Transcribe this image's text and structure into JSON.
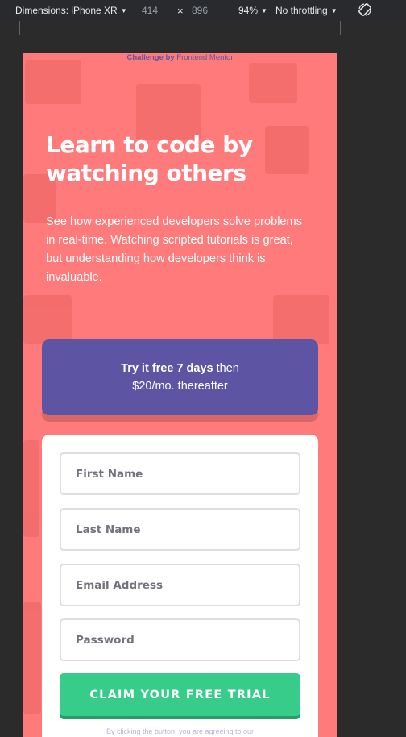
{
  "devtools": {
    "dimensions_label": "Dimensions: iPhone XR",
    "width": "414",
    "times": "×",
    "height": "896",
    "zoom": "94%",
    "throttling": "No throttling",
    "rotate_icon": "rotate-icon"
  },
  "attribution": {
    "prefix": "Challenge by",
    "link": "Frontend Mentor"
  },
  "hero": {
    "headline": "Learn to code by watching others",
    "lead": "See how experienced developers solve problems in real-time. Watching scripted tutorials is great, but understanding how developers think is invaluable."
  },
  "promo": {
    "bold": "Try it free 7 days",
    "rest_line1": " then",
    "line2": "$20/mo. thereafter"
  },
  "form": {
    "first_name_placeholder": "First Name",
    "last_name_placeholder": "Last Name",
    "email_placeholder": "Email Address",
    "password_placeholder": "Password",
    "submit_label": "CLAIM YOUR FREE TRIAL",
    "terms_partial": "By clicking the button, you are agreeing to our"
  },
  "colors": {
    "background": "#ff7a7a",
    "promo": "#5e54a4",
    "cta": "#38cc8b"
  }
}
